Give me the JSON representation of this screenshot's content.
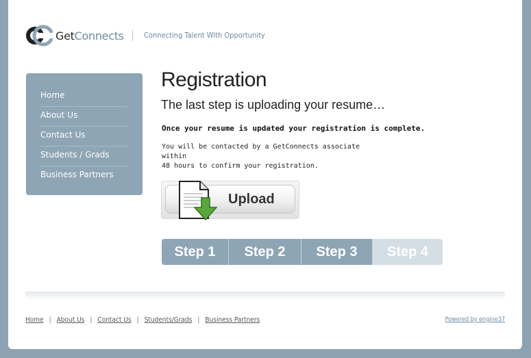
{
  "header": {
    "logo_text_get": "Get",
    "logo_text_connects": "Connects",
    "tagline": "Connecting Talent With Opportunity"
  },
  "sidebar": {
    "items": [
      {
        "label": "Home"
      },
      {
        "label": "About Us"
      },
      {
        "label": "Contact Us"
      },
      {
        "label": "Students / Grads"
      },
      {
        "label": "Business Partners"
      }
    ]
  },
  "main": {
    "title": "Registration",
    "subtitle": "The last step is uploading your resume…",
    "bold_note": "Once your resume is updated your registration is complete.",
    "note_line1": "You will be contacted by a GetConnects associate within",
    "note_line2": "48 hours to confirm your registration.",
    "upload_label": "Upload",
    "upload_icon": "document-download-icon"
  },
  "steps": [
    {
      "label": "Step 1",
      "state": "done"
    },
    {
      "label": "Step 2",
      "state": "done"
    },
    {
      "label": "Step 3",
      "state": "done"
    },
    {
      "label": "Step 4",
      "state": "current"
    }
  ],
  "footer": {
    "links": [
      {
        "label": "Home"
      },
      {
        "label": "About Us"
      },
      {
        "label": "Contact Us"
      },
      {
        "label": "Students/Grads"
      },
      {
        "label": "Business Partners"
      }
    ],
    "powered_by": "Powered by engine37"
  },
  "colors": {
    "accent": "#8ea5b5",
    "accent_light": "#d4dee5",
    "brand_blue": "#6b8aa3"
  }
}
